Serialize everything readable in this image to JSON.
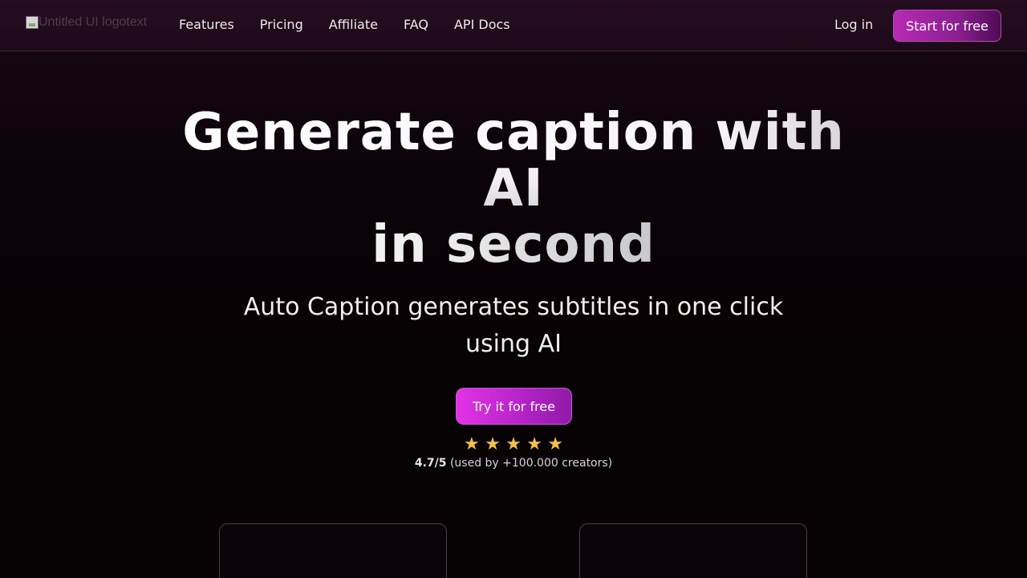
{
  "header": {
    "logo_alt": "Untitled UI logotext",
    "nav": [
      "Features",
      "Pricing",
      "Affiliate",
      "FAQ",
      "API Docs"
    ],
    "login_label": "Log in",
    "cta_label": "Start for free"
  },
  "hero": {
    "title_line1": "Generate caption with",
    "title_line2": "AI",
    "title_line3": "in second",
    "subtitle": "Auto Caption generates subtitles in one click using AI",
    "cta_label": "Try it for free",
    "rating_value": "4.7/5",
    "rating_text": " (used by +100.000 creators)",
    "stars": 5
  },
  "colors": {
    "accent": "#b62bb3",
    "star": "#f7c04a",
    "background": "#070204"
  }
}
